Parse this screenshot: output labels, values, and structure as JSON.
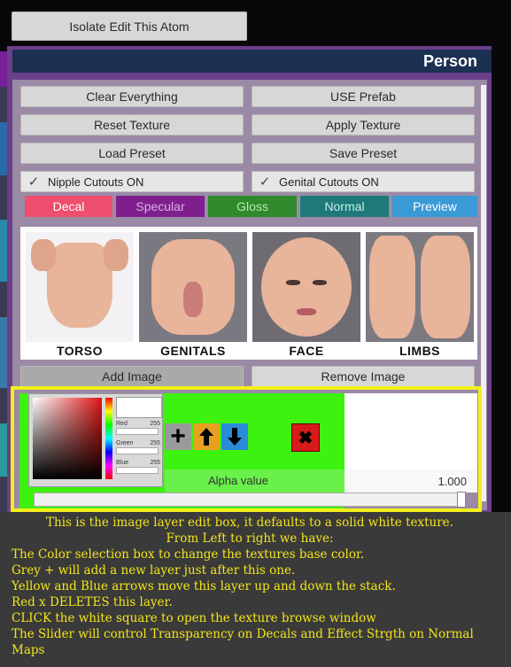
{
  "top_button": {
    "label": "Isolate Edit This Atom"
  },
  "panel": {
    "title": "Person"
  },
  "buttons": {
    "clear_everything": "Clear Everything",
    "use_prefab": "USE Prefab",
    "reset_texture": "Reset Texture",
    "apply_texture": "Apply Texture",
    "load_preset": "Load Preset",
    "save_preset": "Save Preset",
    "add_image": "Add Image",
    "remove_image": "Remove Image"
  },
  "checkboxes": {
    "nipple": {
      "label": "Nipple Cutouts ON",
      "checked": true
    },
    "genital": {
      "label": "Genital Cutouts ON",
      "checked": true
    }
  },
  "tabs": [
    {
      "label": "Decal",
      "color": "#f04e6e"
    },
    {
      "label": "Specular",
      "color": "#7f1f8e"
    },
    {
      "label": "Gloss",
      "color": "#2e8a2a"
    },
    {
      "label": "Normal",
      "color": "#1e7a78"
    },
    {
      "label": "Preview",
      "color": "#3a9ad6"
    }
  ],
  "textures": [
    {
      "label": "TORSO"
    },
    {
      "label": "GENITALS"
    },
    {
      "label": "FACE"
    },
    {
      "label": "LIMBS"
    }
  ],
  "layer": {
    "color_picker": {
      "red_label": "Red",
      "red": "255",
      "green_label": "Green",
      "green": "255",
      "blue_label": "Blue",
      "blue": "255"
    },
    "alpha_label": "Alpha value",
    "alpha_value": "1.000",
    "alpha_fraction": 1.0,
    "icons": [
      "plus-icon",
      "arrow-up-icon",
      "arrow-down-icon",
      "delete-x-icon"
    ]
  },
  "notes": {
    "line1": "This is the image layer edit box, it defaults to a solid white texture.",
    "line2": "From Left to right we have:",
    "line3": "The Color selection box to change the textures base color.",
    "line4": "Grey +  will add a new layer just after this one.",
    "line5": "Yellow and Blue arrows move this layer up and down the stack.",
    "line6": "Red x  DELETES this layer.",
    "line7": "CLICK the white square to open the texture browse window",
    "line8": "The Slider will control Transparency on Decals and Effect Strgth on Normal",
    "line9": "Maps"
  },
  "colors": {
    "highlight": "#f4ef1a",
    "layer_bg": "#3df20f",
    "note_text": "#f2e51a"
  }
}
